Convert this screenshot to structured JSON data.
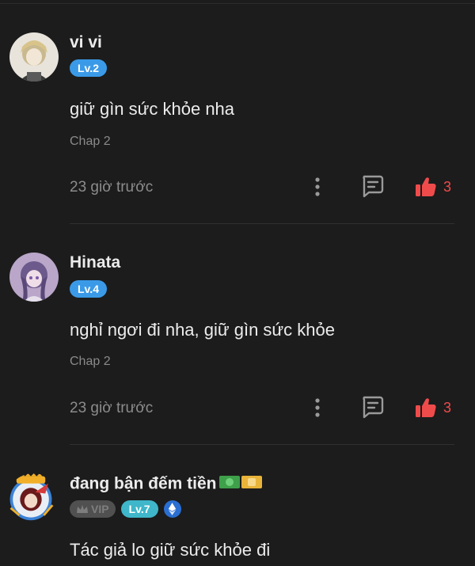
{
  "comments": [
    {
      "name": "vi vi",
      "level": "Lv.2",
      "text": "giữ gìn sức khỏe nha",
      "chapter": "Chap 2",
      "time": "23 giờ trước",
      "likes": "3"
    },
    {
      "name": "Hinata",
      "level": "Lv.4",
      "text": "nghỉ ngơi đi nha, giữ gìn sức khỏe",
      "chapter": "Chap 2",
      "time": "23 giờ trước",
      "likes": "3"
    },
    {
      "name": "đang bận đếm tiền",
      "vip": "VIP",
      "level": "Lv.7",
      "text": "Tác giả lo giữ sức khỏe đi"
    }
  ],
  "colors": {
    "background": "#1c1c1c",
    "like_red": "#f04b4b",
    "level_blue": "#3b9ae8",
    "level_teal": "#3fb6c9"
  },
  "icons": [
    "more-vertical-icon",
    "reply-icon",
    "thumbs-up-icon",
    "crown-icon",
    "ethereum-icon",
    "money-emoji-icon"
  ]
}
